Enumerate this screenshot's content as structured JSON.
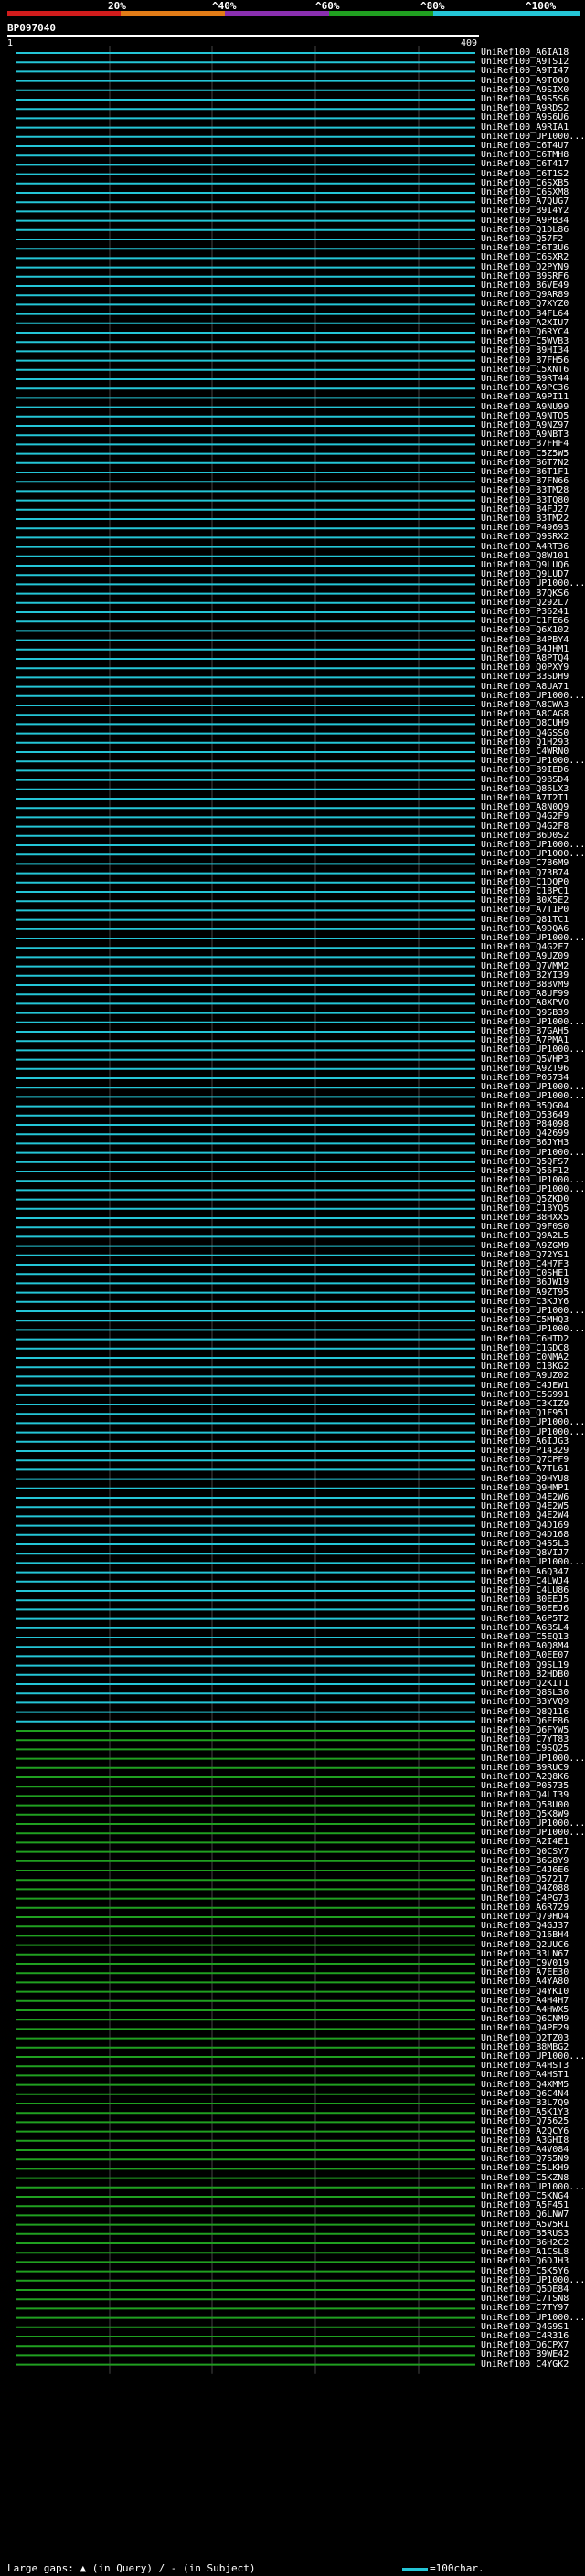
{
  "legend": {
    "labels": [
      "20%",
      "^40%",
      "^60%",
      "^80%",
      "^100%"
    ],
    "colors": [
      "#d11c1c",
      "#e27c17",
      "#8a2fb0",
      "#20a020",
      "#24c5d6"
    ]
  },
  "query": {
    "title": "BP097040",
    "start": "1",
    "end": "409"
  },
  "hits": [
    "UniRef100_A6IA18",
    "UniRef100_A9TS12",
    "UniRef100_A9TI47",
    "UniRef100_A9T000",
    "UniRef100_A9SIX0",
    "UniRef100_A9S5S6",
    "UniRef100_A9RDS2",
    "UniRef100_A9S6U6",
    "UniRef100_A9RIA1",
    "UniRef100_UP1000...",
    "UniRef100_C6T4U7",
    "UniRef100_C6TMH8",
    "UniRef100_C6T417",
    "UniRef100_C6T1S2",
    "UniRef100_C6SXB5",
    "UniRef100_C6SXM8",
    "UniRef100_A7QUG7",
    "UniRef100_B9I4Y2",
    "UniRef100_A9PB34",
    "UniRef100_Q1DL86",
    "UniRef100_Q57F2",
    "UniRef100_C6T3U6",
    "UniRef100_C6SXR2",
    "UniRef100_Q2PYN9",
    "UniRef100_B9SRF6",
    "UniRef100_B6VE49",
    "UniRef100_Q9AR89",
    "UniRef100_Q7XYZ0",
    "UniRef100_B4FL64",
    "UniRef100_A2XIU7",
    "UniRef100_Q6RYC4",
    "UniRef100_C5WVB3",
    "UniRef100_B9HI34",
    "UniRef100_B7FH56",
    "UniRef100_C5XNT6",
    "UniRef100_B9RT44",
    "UniRef100_A9PC36",
    "UniRef100_A9PI11",
    "UniRef100_A9NU99",
    "UniRef100_A9NTQ5",
    "UniRef100_A9NZ97",
    "UniRef100_A9NBT3",
    "UniRef100_B7FHF4",
    "UniRef100_C5Z5W5",
    "UniRef100_B6T7N2",
    "UniRef100_B6T1F1",
    "UniRef100_B7FN66",
    "UniRef100_B3TM28",
    "UniRef100_B3TQ80",
    "UniRef100_B4FJ27",
    "UniRef100_B3TM22",
    "UniRef100_P49693",
    "UniRef100_Q9SRX2",
    "UniRef100_A4RT36",
    "UniRef100_Q8W101",
    "UniRef100_Q9LUQ6",
    "UniRef100_Q9LUD7",
    "UniRef100_UP1000...",
    "UniRef100_B7QKS6",
    "UniRef100_Q292L7",
    "UniRef100_P36241",
    "UniRef100_C1FE66",
    "UniRef100_Q6X102",
    "UniRef100_B4PBY4",
    "UniRef100_B4JHM1",
    "UniRef100_A8PTQ4",
    "UniRef100_Q0PXY9",
    "UniRef100_B3SDH9",
    "UniRef100_A8UA71",
    "UniRef100_UP1000...",
    "UniRef100_A8CWA3",
    "UniRef100_A8CAG8",
    "UniRef100_Q8CUH9",
    "UniRef100_Q4GSS0",
    "UniRef100_Q1H293",
    "UniRef100_C4WRN0",
    "UniRef100_UP1000...",
    "UniRef100_B9IED6",
    "UniRef100_Q9BSD4",
    "UniRef100_Q86LX3",
    "UniRef100_A7T2T1",
    "UniRef100_A8N0Q9",
    "UniRef100_Q4G2F9",
    "UniRef100_Q4G2F8",
    "UniRef100_B6D0S2",
    "UniRef100_UP1000...",
    "UniRef100_UP1000...",
    "UniRef100_C7B6M9",
    "UniRef100_Q73B74",
    "UniRef100_C1DQP0",
    "UniRef100_C1BPC1",
    "UniRef100_B0X5E2",
    "UniRef100_A7T1P0",
    "UniRef100_Q81TC1",
    "UniRef100_A9DQA6",
    "UniRef100_UP1000...",
    "UniRef100_Q4G2F7",
    "UniRef100_A9UZ09",
    "UniRef100_Q7VMM2",
    "UniRef100_B2YI39",
    "UniRef100_B8BVM9",
    "UniRef100_A8UF99",
    "UniRef100_A8XPV0",
    "UniRef100_Q9SB39",
    "UniRef100_UP1000...",
    "UniRef100_B7GAH5",
    "UniRef100_A7PMA1",
    "UniRef100_UP1000...",
    "UniRef100_Q5VHP3",
    "UniRef100_A9ZT96",
    "UniRef100_P05734",
    "UniRef100_UP1000...",
    "UniRef100_UP1000...",
    "UniRef100_B5QG04",
    "UniRef100_Q53649",
    "UniRef100_P84098",
    "UniRef100_Q42699",
    "UniRef100_B6JYH3",
    "UniRef100_UP1000...",
    "UniRef100_Q5QFS7",
    "UniRef100_Q56F12",
    "UniRef100_UP1000...",
    "UniRef100_UP1000...",
    "UniRef100_Q5ZKD0",
    "UniRef100_C1BYQ5",
    "UniRef100_B8HXX5",
    "UniRef100_Q9F0S0",
    "UniRef100_Q9A2L5",
    "UniRef100_A9ZGM9",
    "UniRef100_Q72YS1",
    "UniRef100_C4H7F3",
    "UniRef100_C0SHE1",
    "UniRef100_B6JW19",
    "UniRef100_A9ZT95",
    "UniRef100_C3KJY6",
    "UniRef100_UP1000...",
    "UniRef100_C5MHQ3",
    "UniRef100_UP1000...",
    "UniRef100_C6HTD2",
    "UniRef100_C1GDC8",
    "UniRef100_C0NMA2",
    "UniRef100_C1BKG2",
    "UniRef100_A9UZ02",
    "UniRef100_C4JEW1",
    "UniRef100_C5G991",
    "UniRef100_C3KIZ9",
    "UniRef100_Q1F951",
    "UniRef100_UP1000...",
    "UniRef100_UP1000...",
    "UniRef100_A6IJG3",
    "UniRef100_P14329",
    "UniRef100_Q7CPF9",
    "UniRef100_A7TL61",
    "UniRef100_Q9HYU8",
    "UniRef100_Q9HMP1",
    "UniRef100_Q4E2W6",
    "UniRef100_Q4E2W5",
    "UniRef100_Q4E2W4",
    "UniRef100_Q4D169",
    "UniRef100_Q4D168",
    "UniRef100_Q4S5L3",
    "UniRef100_Q8VIJ7",
    "UniRef100_UP1000...",
    "UniRef100_A6Q347",
    "UniRef100_C4LWJ4",
    "UniRef100_C4LU86",
    "UniRef100_B0EEJ5",
    "UniRef100_B0EEJ6",
    "UniRef100_A6P5T2",
    "UniRef100_A6BSL4",
    "UniRef100_C5EQ13",
    "UniRef100_A0Q8M4",
    "UniRef100_A0EE07",
    "UniRef100_Q9SL19",
    "UniRef100_B2HDB0",
    "UniRef100_Q2KIT1",
    "UniRef100_Q8SL30",
    "UniRef100_B3YVQ9",
    "UniRef100_Q8Q116",
    "UniRef100_Q6EE86",
    "UniRef100_Q6FYW5",
    "UniRef100_C7YT83",
    "UniRef100_C9SQ25",
    "UniRef100_UP1000...",
    "UniRef100_B9RUC9",
    "UniRef100_A2Q8K6",
    "UniRef100_P05735",
    "UniRef100_Q4LI39",
    "UniRef100_Q58U00",
    "UniRef100_Q5K8W9",
    "UniRef100_UP1000...",
    "UniRef100_UP1000...",
    "UniRef100_A2I4E1",
    "UniRef100_Q0CSY7",
    "UniRef100_B6G8Y9",
    "UniRef100_C4J6E6",
    "UniRef100_Q57217",
    "UniRef100_Q4Z088",
    "UniRef100_C4PG73",
    "UniRef100_A6R729",
    "UniRef100_Q79HO4",
    "UniRef100_Q4GJ37",
    "UniRef100_Q16BH4",
    "UniRef100_Q2UUC6",
    "UniRef100_B3LN67",
    "UniRef100_C9V019",
    "UniRef100_A7EE30",
    "UniRef100_A4YA80",
    "UniRef100_Q4YKI0",
    "UniRef100_A4H4H7",
    "UniRef100_A4HWX5",
    "UniRef100_Q6CNM9",
    "UniRef100_Q4PE29",
    "UniRef100_Q2TZ03",
    "UniRef100_B8MBG2",
    "UniRef100_UP1000...",
    "UniRef100_A4HST3",
    "UniRef100_A4HST1",
    "UniRef100_Q4XMM5",
    "UniRef100_Q6C4N4",
    "UniRef100_B3L7Q9",
    "UniRef100_A5K1Y3",
    "UniRef100_Q75625",
    "UniRef100_A2QCY6",
    "UniRef100_A3GHI8",
    "UniRef100_A4V084",
    "UniRef100_Q7S5N9",
    "UniRef100_C5LKH9",
    "UniRef100_C5KZN8",
    "UniRef100_UP1000...",
    "UniRef100_C5KNG4",
    "UniRef100_A5F451",
    "UniRef100_Q6LNW7",
    "UniRef100_A5V5R1",
    "UniRef100_B5RUS3",
    "UniRef100_B6H2C2",
    "UniRef100_A1CSL8",
    "UniRef100_Q6DJH3",
    "UniRef100_C5K5Y6",
    "UniRef100_UP1000...",
    "UniRef100_Q5DE84",
    "UniRef100_C7TSN8",
    "UniRef100_C7TY97",
    "UniRef100_UP1000...",
    "UniRef100_Q4G9S1",
    "UniRef100_C4R316",
    "UniRef100_Q6CPX7",
    "UniRef100_B9WE42",
    "UniRef100_C4YGK2"
  ],
  "footer": {
    "left": "Large gaps: ▲ (in Query) / - (in Subject)",
    "right": "=100char."
  }
}
